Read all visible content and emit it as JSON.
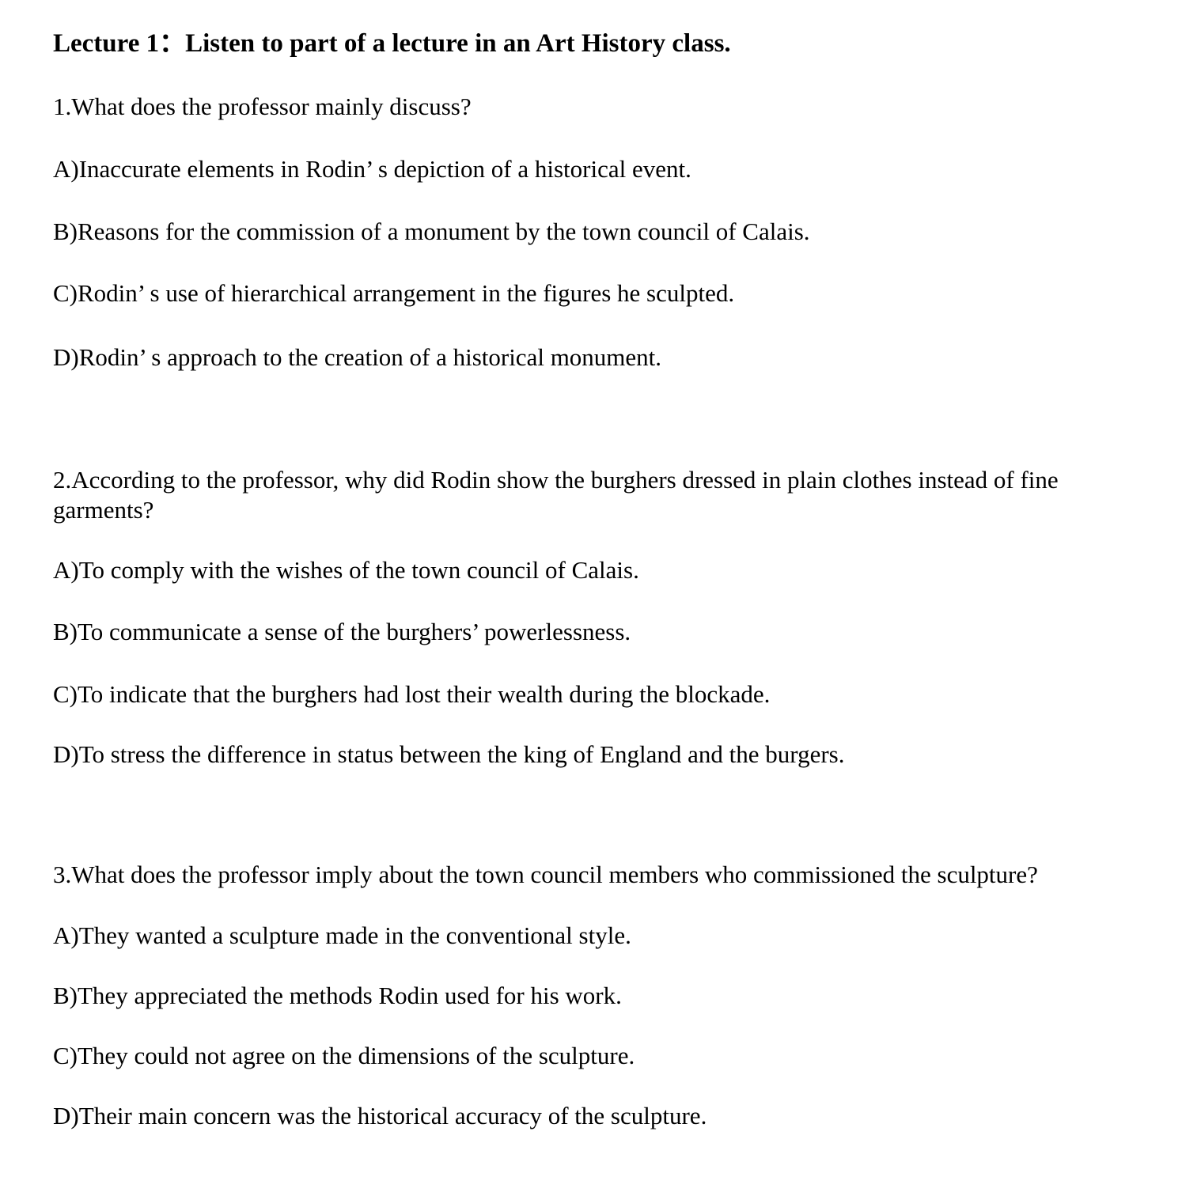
{
  "title": "Lecture 1：Listen to part of a lecture in an Art History class.",
  "questions": [
    {
      "prompt": "1.What does the professor mainly discuss?",
      "options": [
        "A)Inaccurate elements in Rodin’ s depiction of a historical event.",
        "B)Reasons for the commission of a monument by the town council of Calais.",
        "C)Rodin’ s use of hierarchical arrangement in the figures he sculpted.",
        "D)Rodin’ s approach to the creation of a historical monument."
      ]
    },
    {
      "prompt": "2.According to the professor, why did Rodin show the burghers dressed in plain clothes instead of fine garments?",
      "options": [
        "A)To comply with the wishes of the town council of Calais.",
        "B)To communicate a sense of the burghers’ powerlessness.",
        "C)To indicate that the burghers had lost their wealth during the blockade.",
        "D)To stress the difference in status between the king of England and the burgers."
      ]
    },
    {
      "prompt": "3.What does the professor imply about the town council members who commissioned the sculpture?",
      "options": [
        "A)They wanted a sculpture made in the conventional style.",
        "B)They appreciated the methods Rodin used for his work.",
        "C)They could not agree on the dimensions of the sculpture.",
        "D)Their main concern was the historical accuracy of the sculpture."
      ]
    }
  ]
}
